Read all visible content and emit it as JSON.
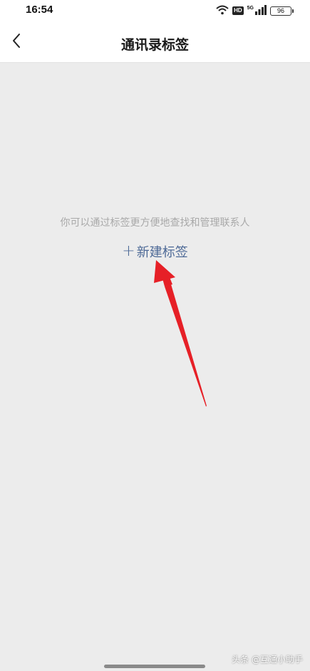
{
  "status_bar": {
    "time": "16:54",
    "network": "5G",
    "hd": "HD",
    "battery": "96"
  },
  "header": {
    "title": "通讯录标签"
  },
  "main": {
    "empty_hint": "你可以通过标签更方便地查找和管理联系人",
    "new_tag": {
      "plus": "+",
      "label": "新建标签"
    }
  },
  "colors": {
    "accent": "#4e6a97",
    "arrow": "#e62027",
    "background": "#ececec"
  },
  "watermark": "头条 @互通小助手"
}
